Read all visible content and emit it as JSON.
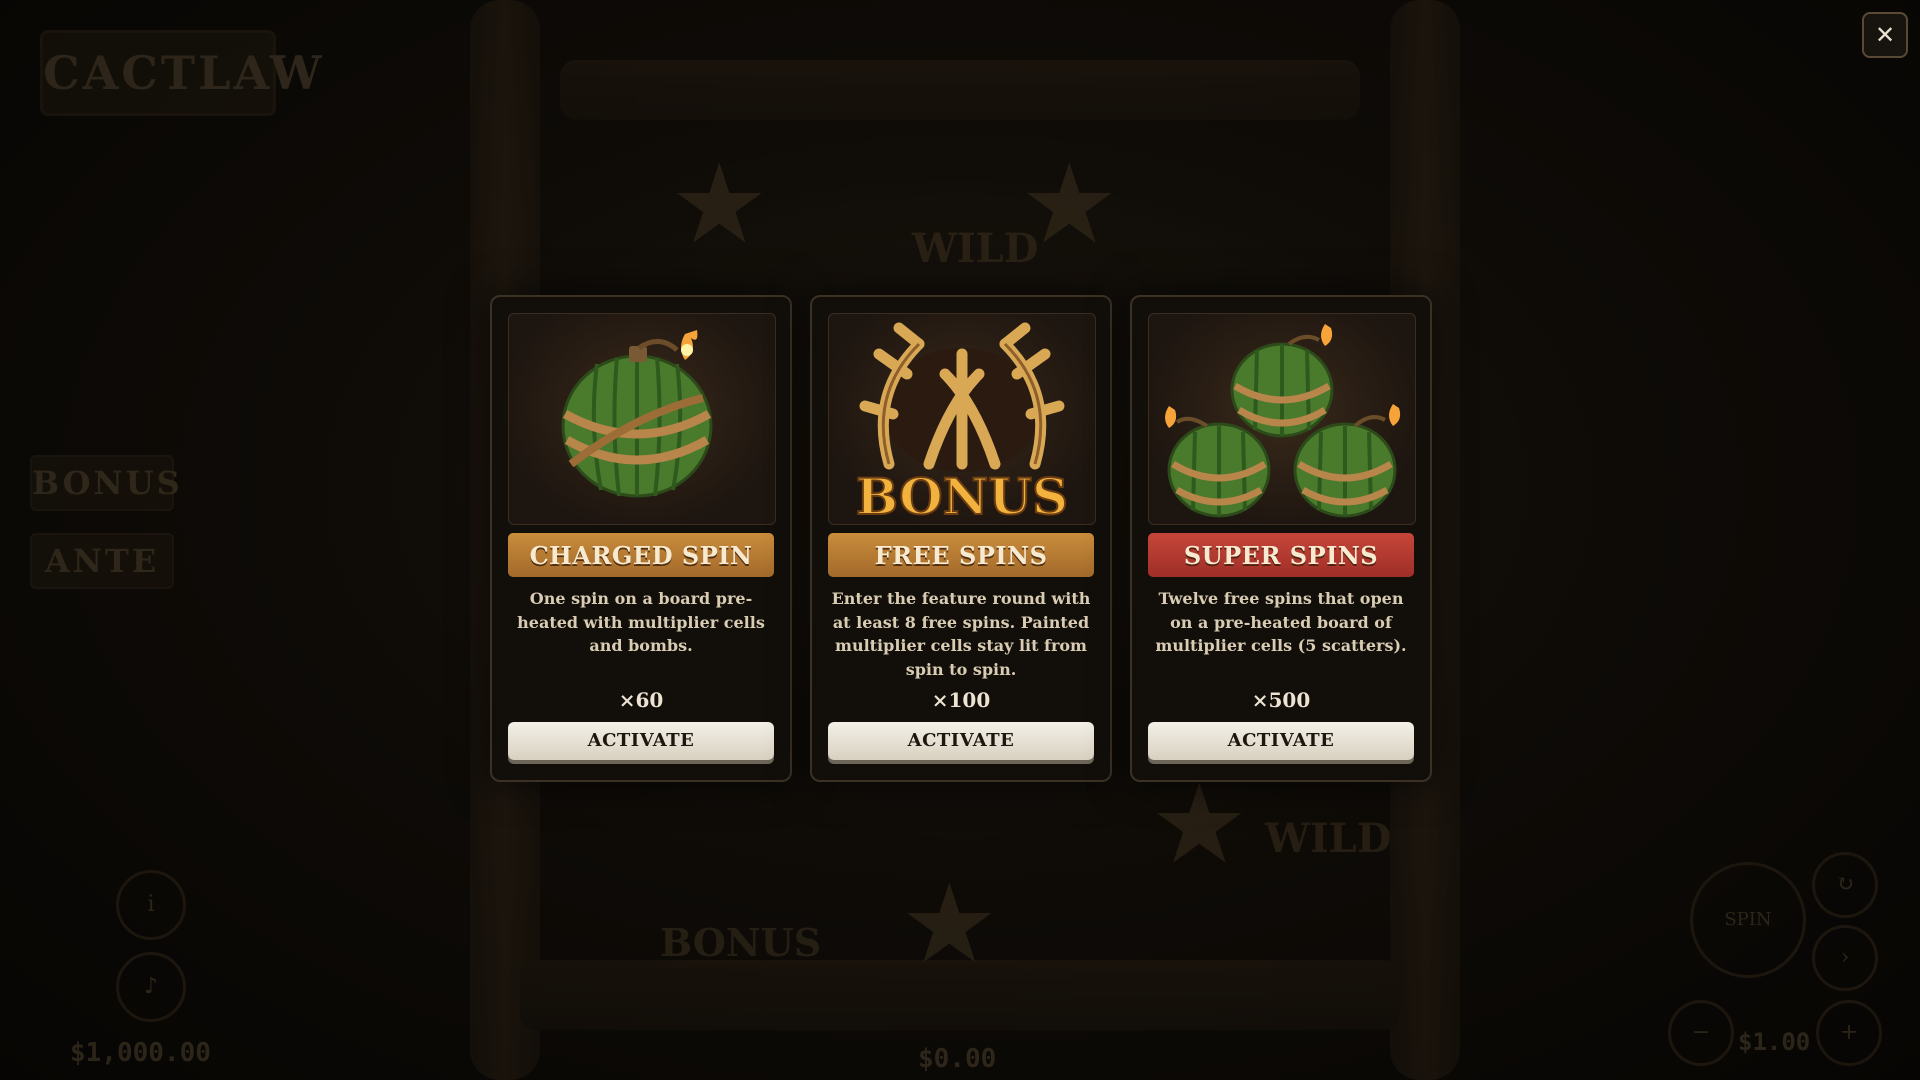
{
  "background": {
    "logo": "CACTLAW",
    "side_buttons": [
      "BONUS",
      "ANTE"
    ],
    "balance": "$1,000.00",
    "win": "$0.00",
    "bet": "$1.00",
    "spin_label": "SPIN",
    "reel_words": {
      "wild_top": "WILD",
      "wild_bottom": "WILD",
      "bonus_bottom": "BONUS"
    }
  },
  "close_button": {
    "icon": "close-icon",
    "label": "✕"
  },
  "cards": [
    {
      "id": "charged-spin",
      "title": "CHARGED SPIN",
      "description": "One spin on a board pre-heated with multiplier cells and bombs.",
      "price": "×60",
      "button": "ACTIVATE",
      "banner_color": "#b67a33",
      "art": "single-cactus-bomb"
    },
    {
      "id": "free-spins",
      "title": "FREE SPINS",
      "description": "Enter the feature round with at least 8 free spins. Painted multiplier cells stay lit from spin to spin.",
      "price": "×100",
      "button": "ACTIVATE",
      "banner_color": "#b67a33",
      "art": "antler-bonus",
      "art_text": "BONUS"
    },
    {
      "id": "super-spins",
      "title": "SUPER SPINS",
      "description": "Twelve free spins that open on a pre-heated board of multiplier cells (5 scatters).",
      "price": "×500",
      "button": "ACTIVATE",
      "banner_color": "#b43a30",
      "art": "triple-cactus-bombs"
    }
  ]
}
